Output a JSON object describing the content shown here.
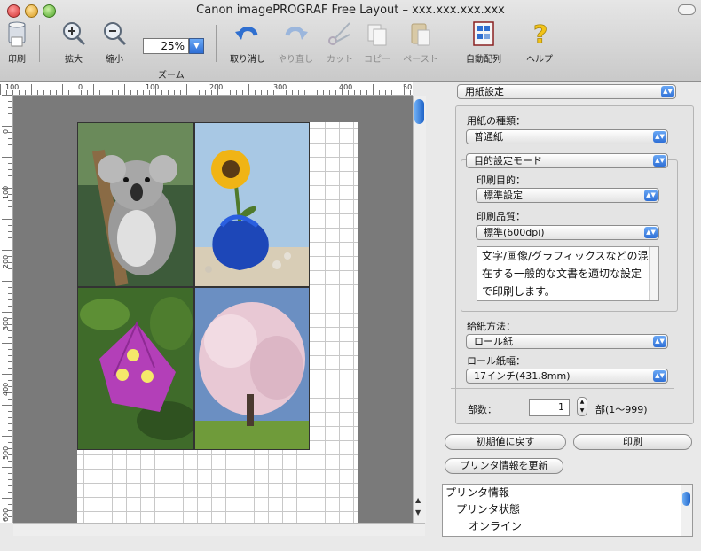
{
  "window": {
    "title": "Canon imagePROGRAF Free Layout – xxx.xxx.xxx.xxx"
  },
  "toolbar": {
    "print_label": "印刷",
    "zoom_in_label": "拡大",
    "zoom_out_label": "縮小",
    "zoom_label": "ズーム",
    "zoom_value": "25%",
    "undo_label": "取り消し",
    "redo_label": "やり直し",
    "cut_label": "カット",
    "copy_label": "コピー",
    "paste_label": "ペースト",
    "auto_layout_label": "自動配列",
    "help_label": "ヘルプ"
  },
  "ruler": {
    "h_ticks": [
      "100",
      "0",
      "100",
      "200",
      "300",
      "400",
      "50"
    ],
    "v_ticks": [
      "0",
      "100",
      "200",
      "300",
      "400",
      "500",
      "600"
    ]
  },
  "canvas": {
    "photos": [
      "koala",
      "sunflower",
      "bougainvillea",
      "cherry-blossom-tree"
    ]
  },
  "panel": {
    "settings_select": "用紙設定",
    "paper_type_label": "用紙の種類：",
    "paper_type_value": "普通紙",
    "mode_select": "目的設定モード",
    "purpose_label": "印刷目的：",
    "purpose_value": "標準設定",
    "quality_label": "印刷品質：",
    "quality_value": "標準(600dpi)",
    "description": "文字/画像/グラフィックスなどの混在する一般的な文書を適切な設定で印刷します。",
    "feed_label": "給紙方法：",
    "feed_value": "ロール紙",
    "roll_width_label": "ロール紙幅：",
    "roll_width_value": "17インチ(431.8mm)",
    "copies_label": "部数：",
    "copies_value": "1",
    "copies_range": "部(1〜999)",
    "reset_button": "初期値に戻す",
    "print_button": "印刷",
    "update_printer_button": "プリンタ情報を更新",
    "printer_info": {
      "line1": "プリンタ情報",
      "line2": "プリンタ状態",
      "line3": "オンライン"
    }
  },
  "colors": {
    "accent_blue": "#2e6fd6",
    "canvas_gray": "#7a7a7a"
  }
}
